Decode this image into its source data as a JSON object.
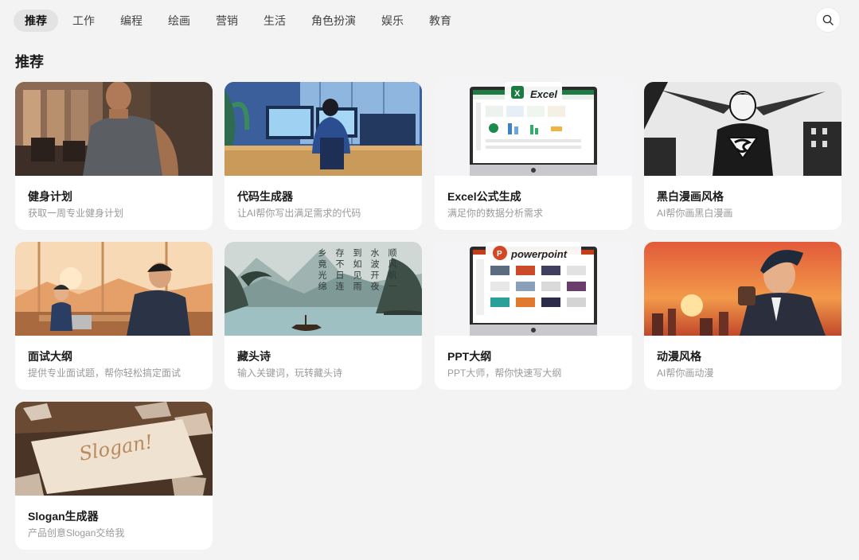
{
  "tabs": [
    {
      "label": "推荐",
      "active": true
    },
    {
      "label": "工作"
    },
    {
      "label": "编程"
    },
    {
      "label": "绘画"
    },
    {
      "label": "营销"
    },
    {
      "label": "生活"
    },
    {
      "label": "角色扮演"
    },
    {
      "label": "娱乐"
    },
    {
      "label": "教育"
    }
  ],
  "search": {
    "icon": "search-icon"
  },
  "section": {
    "title": "推荐"
  },
  "cards": [
    {
      "title": "健身计划",
      "desc": "获取一周专业健身计划"
    },
    {
      "title": "代码生成器",
      "desc": "让AI帮你写出满足需求的代码"
    },
    {
      "title": "Excel公式生成",
      "desc": "满足你的数据分析需求",
      "thumb_text": "Excel"
    },
    {
      "title": "黑白漫画风格",
      "desc": "AI帮你画黑白漫画"
    },
    {
      "title": "面试大纲",
      "desc": "提供专业面试题，帮你轻松搞定面试"
    },
    {
      "title": "藏头诗",
      "desc": "输入关键词，玩转藏头诗",
      "poem": [
        "顺风帆一",
        "水波开夜",
        "到如见雨",
        "存不日连",
        "乡竟光绵"
      ]
    },
    {
      "title": "PPT大纲",
      "desc": "PPT大师，帮你快速写大纲",
      "thumb_text": "powerpoint"
    },
    {
      "title": "动漫风格",
      "desc": "AI帮你画动漫"
    },
    {
      "title": "Slogan生成器",
      "desc": "产品创意Slogan交给我",
      "thumb_text": "Slogan!"
    }
  ]
}
